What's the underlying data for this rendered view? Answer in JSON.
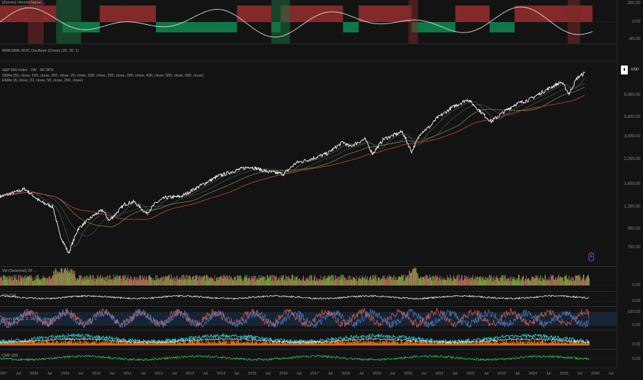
{
  "chart_data": [
    {
      "type": "area",
      "panel": "top-oscillator",
      "title": "[Zscore] +Norm+Signal ...",
      "yticks": [
        200.0,
        0.0,
        -60.0
      ],
      "ylim": [
        -60,
        200
      ],
      "colors": {
        "positive": "#a83232",
        "negative": "#0f8a50",
        "line": "#e0e0e0"
      }
    },
    {
      "type": "line",
      "panel": "roc-oscillator",
      "title": "WRESBAL ROC Oscillator (Clean) (26, 26, 1)"
    },
    {
      "type": "line",
      "panel": "price",
      "title": "S&P 500 Index · 1W · SP:SPX",
      "indicators": [
        "SMAs (50, close, 150, close, 200, close, 20, close, 200, close, 250, close, 300, close, 400, close, 500, close, 600, close)",
        "EMAs (8, close, 20, close, 50, close, 200, close)"
      ],
      "currency": "USD",
      "log_scale": true,
      "yticks": [
        5000.0,
        3800.0,
        3000.0,
        2250.0,
        1650.0,
        1250.0,
        950.0,
        750.0
      ],
      "ylim": [
        650,
        7000
      ],
      "x": [
        2007.0,
        2007.5,
        2007.8,
        2008.3,
        2008.7,
        2008.9,
        2009.2,
        2009.5,
        2010.0,
        2010.3,
        2010.5,
        2011.0,
        2011.3,
        2011.7,
        2012.0,
        2012.3,
        2012.8,
        2013.0,
        2013.5,
        2014.0,
        2014.5,
        2015.0,
        2015.6,
        2016.1,
        2016.5,
        2017.0,
        2017.5,
        2018.0,
        2018.2,
        2018.7,
        2018.95,
        2019.3,
        2019.9,
        2020.2,
        2020.5,
        2020.8,
        2021.0,
        2021.5,
        2022.0,
        2022.4,
        2022.75,
        2023.0,
        2023.5,
        2024.0,
        2024.6,
        2025.0,
        2025.25,
        2025.5,
        2025.75
      ],
      "series": [
        {
          "values": [
            1420,
            1500,
            1560,
            1330,
            1250,
            900,
            700,
            950,
            1120,
            1200,
            1050,
            1290,
            1330,
            1150,
            1310,
            1400,
            1420,
            1480,
            1650,
            1830,
            1950,
            2060,
            1930,
            1880,
            2160,
            2270,
            2430,
            2800,
            2640,
            2900,
            2420,
            2900,
            3180,
            2480,
            3150,
            3400,
            3750,
            4300,
            4760,
            4100,
            3600,
            3900,
            4450,
            4770,
            5450,
            5900,
            5100,
            6200,
            6600
          ]
        }
      ]
    },
    {
      "type": "bar",
      "panel": "volume",
      "title": "Vol (Seasonal) 20 ...",
      "yticks": [
        0.0
      ]
    },
    {
      "type": "line",
      "panel": "osc-a",
      "yticks": [
        0.0
      ]
    },
    {
      "type": "line",
      "panel": "stoch",
      "title": "Stoch RSI (3, 3, 14, 14, close)",
      "yticks": [
        100.0,
        0.0
      ]
    },
    {
      "type": "line",
      "panel": "multi-osc",
      "yticks": [
        0.0
      ]
    },
    {
      "type": "line",
      "panel": "cmf",
      "title": "CMF (20)",
      "yticks": [
        0.0
      ]
    }
  ],
  "x_axis_labels": [
    "2007",
    "Jul",
    "2008",
    "Jul",
    "2009",
    "Jul",
    "2010",
    "Jul",
    "2011",
    "Jul",
    "2012",
    "Jul",
    "2013",
    "Jul",
    "2014",
    "Jul",
    "2015",
    "Jul",
    "2016",
    "Jul",
    "2017",
    "Jul",
    "2018",
    "Jul",
    "2019",
    "Jul",
    "2020",
    "Jul",
    "2021",
    "Jul",
    "2022",
    "Jul",
    "2023",
    "Jul",
    "2024",
    "Jul",
    "2025",
    "Jul",
    "2026",
    "Jul"
  ],
  "price_axis_labels": [
    "5,000.00",
    "3,800.00",
    "3,000.00",
    "2,250.00",
    "1,650.00",
    "1,250.00",
    "950.00",
    "750.00"
  ],
  "top_axis_labels": [
    "200.00",
    "0.00",
    "-60.00"
  ],
  "currency_tag": "USD",
  "marker_label": "E",
  "legends": {
    "top": "[Zscore] +Norm+Signal ...",
    "roc": "WRESBAL ROC Oscillator (Clean) (26, 26, 1)",
    "price_title": "S&P 500 Index · 1W · SP:SPX",
    "smas": "SMAs (50, close, 150, close, 200, close, 20, close, 200, close, 250, close, 300, close, 400, close, 500, close, 600, close)",
    "emas": "EMAs (8, close, 20, close, 50, close, 200, close)",
    "vol": "Vol (Seasonal) 20 ...",
    "osc": "RSI (14)",
    "stoch": "Stoch RSI (3, 3, 14, 14, close)",
    "multi": "Multi Osc ...",
    "cmf": "CMF (20)"
  },
  "small_axis": {
    "vol": "0.00",
    "osc": "0.00",
    "stoch_top": "100.00",
    "stoch_bot": "0.00",
    "multi": "0.00",
    "cmf": "0.00"
  },
  "colors": {
    "background": "#131313",
    "price": "#ffffff",
    "sma_gray": "#8a8a8a",
    "ema_green": "#6f8f3a",
    "ema_red": "#b8443a",
    "stoch_band": "#1a3552",
    "vol_green": "#7fa63e",
    "vol_red": "#b86060",
    "cyan": "#22d3d3",
    "orange": "#f07a1a"
  }
}
